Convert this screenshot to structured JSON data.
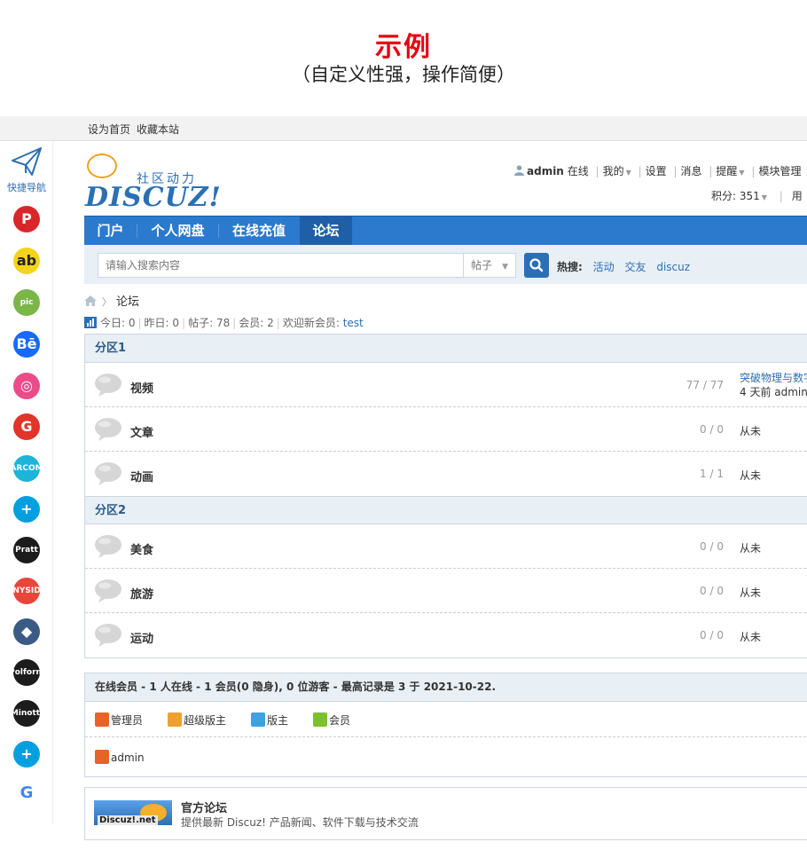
{
  "hero": {
    "title": "示例",
    "subtitle": "（自定义性强，操作简便）"
  },
  "topbar": {
    "set_home": "设为首页",
    "bookmark": "收藏本站"
  },
  "quicknav": {
    "label": "快捷导航",
    "icons": [
      {
        "name": "pinterest-icon",
        "text": "P",
        "color": "#d9262a"
      },
      {
        "name": "app-icon",
        "text": "ab",
        "color": "#f3d41a"
      },
      {
        "name": "pic-icon",
        "text": "pic",
        "color": "#7ab648"
      },
      {
        "name": "behance-icon",
        "text": "Bē",
        "color": "#1769ff"
      },
      {
        "name": "dribbble-icon",
        "text": "◎",
        "color": "#ea4c89"
      },
      {
        "name": "google-icon",
        "text": "G",
        "color": "#e2342a"
      },
      {
        "name": "arcom-icon",
        "text": "ARCOM",
        "color": "#1eb3d8"
      },
      {
        "name": "plus-icon",
        "text": "+",
        "color": "#00a0e0"
      },
      {
        "name": "pratt-icon",
        "text": "Pratt",
        "color": "#1c1c1c"
      },
      {
        "name": "interior-design-icon",
        "text": "NYSID",
        "color": "#e8463a"
      },
      {
        "name": "shield-icon",
        "text": "◆",
        "color": "#3b5a86"
      },
      {
        "name": "polform-icon",
        "text": "Polform",
        "color": "#1c1c1c"
      },
      {
        "name": "minotti-icon",
        "text": "Minotti",
        "color": "#1c1c1c"
      },
      {
        "name": "plus-icon-2",
        "text": "+",
        "color": "#00a0e0"
      },
      {
        "name": "google-color-icon",
        "text": "G",
        "color": "#ffffff"
      }
    ]
  },
  "header": {
    "slogan": "社区动力",
    "logo_word": "DISCUZ!",
    "user": "admin",
    "online": "在线",
    "menu": [
      "我的",
      "设置",
      "消息",
      "提醒",
      "模块管理"
    ],
    "points": "积分: 351",
    "user_group": "用"
  },
  "nav": {
    "items": [
      "门户",
      "个人网盘",
      "在线充值",
      "论坛"
    ]
  },
  "search": {
    "placeholder": "请输入搜索内容",
    "type": "帖子",
    "hot_label": "热搜:",
    "hot": [
      "活动",
      "交友",
      "discuz"
    ]
  },
  "breadcrumb": {
    "current": "论坛"
  },
  "stats": {
    "today": "今日: 0",
    "yesterday": "昨日: 0",
    "posts": "帖子: 78",
    "members": "会员: 2",
    "welcome": "欢迎新会员:",
    "newest": "test"
  },
  "sections": [
    {
      "title": "分区1",
      "forums": [
        {
          "name": "视频",
          "count": "77 / 77",
          "last_title": "突破物理与数字",
          "last_meta": "4 天前 admin"
        },
        {
          "name": "文章",
          "count": "0 / 0",
          "last_title": "",
          "last_meta": "从未"
        },
        {
          "name": "动画",
          "count": "1 / 1",
          "last_title": "",
          "last_meta": "从未"
        }
      ]
    },
    {
      "title": "分区2",
      "forums": [
        {
          "name": "美食",
          "count": "0 / 0",
          "last_title": "",
          "last_meta": "从未"
        },
        {
          "name": "旅游",
          "count": "0 / 0",
          "last_title": "",
          "last_meta": "从未"
        },
        {
          "name": "运动",
          "count": "0 / 0",
          "last_title": "",
          "last_meta": "从未"
        }
      ]
    }
  ],
  "online": {
    "summary": "在线会员 - 1 人在线 - 1 会员(0 隐身), 0 位游客 - 最高记录是 3 于 2021-10-22.",
    "legend": [
      {
        "label": "管理员",
        "color": "#e8632a"
      },
      {
        "label": "超级版主",
        "color": "#f0a030"
      },
      {
        "label": "版主",
        "color": "#3fa2e0"
      },
      {
        "label": "会员",
        "color": "#7cc12a"
      }
    ],
    "members": [
      {
        "name": "admin",
        "color": "#e8632a"
      }
    ]
  },
  "links": {
    "image_label": "Discuz!.net",
    "title": "官方论坛",
    "desc": "提供最新 Discuz! 产品新闻、软件下载与技术交流"
  }
}
